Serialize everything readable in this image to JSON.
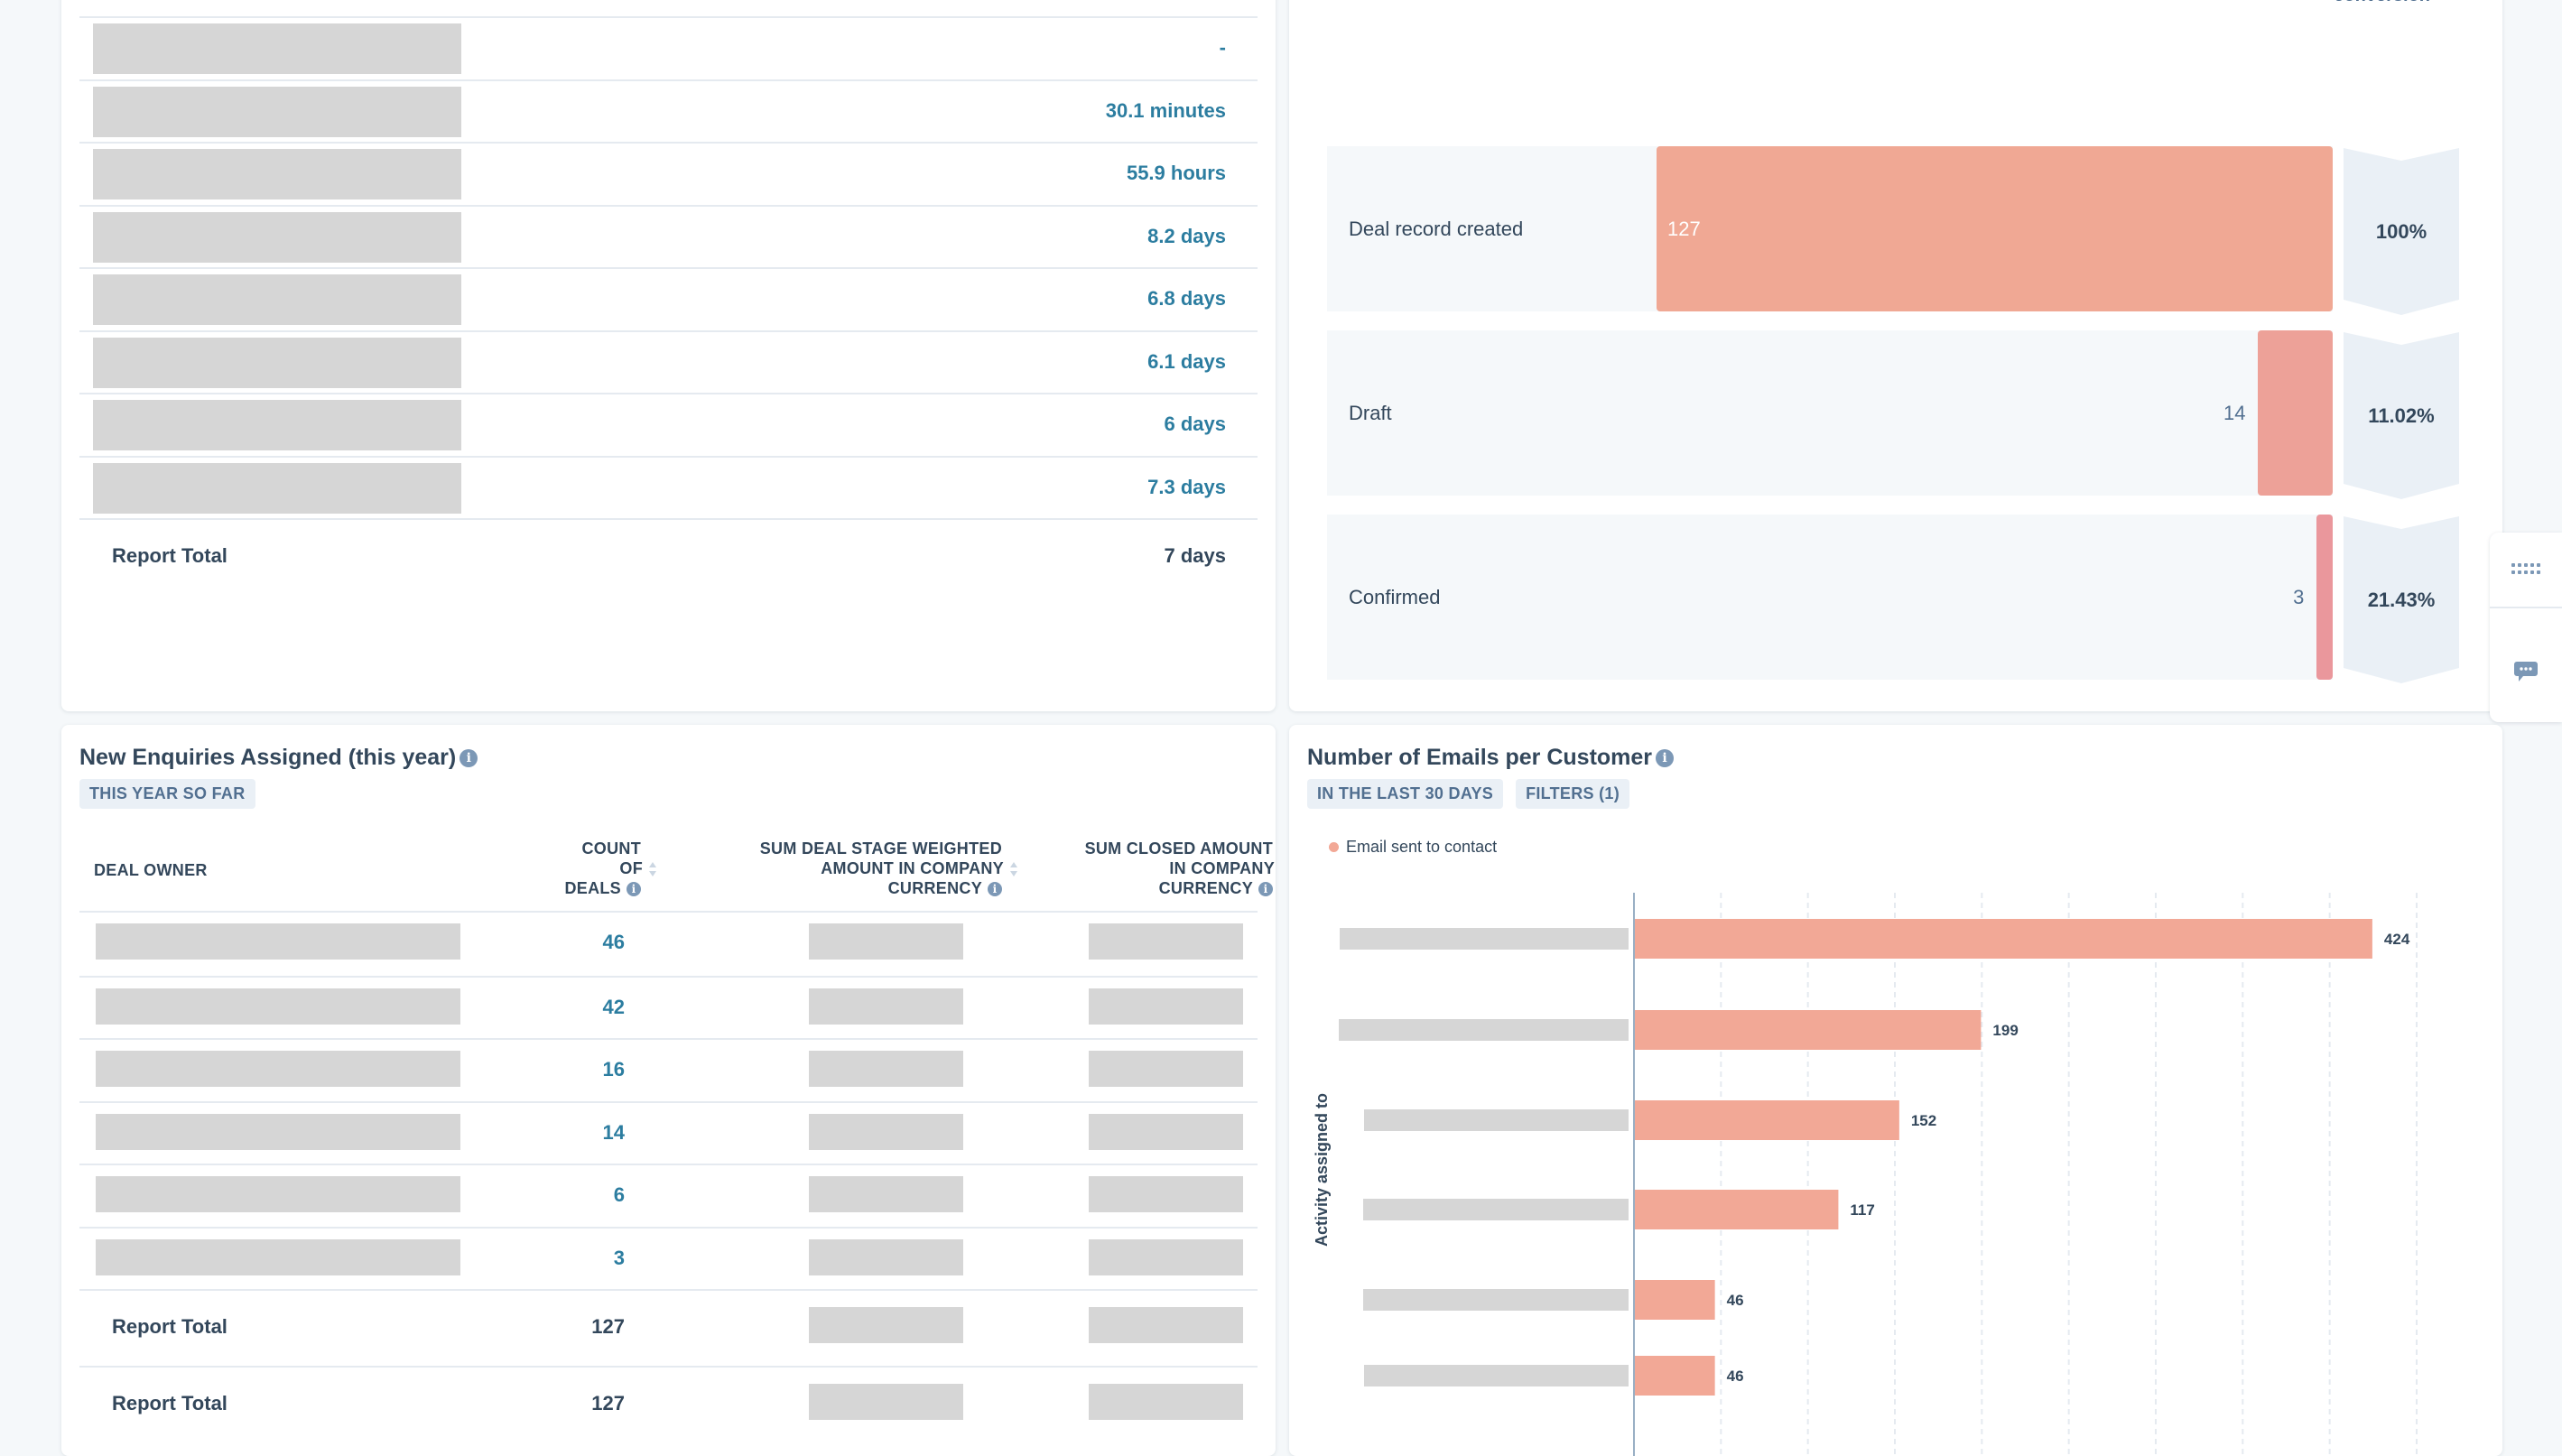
{
  "time_table": {
    "rows": [
      {
        "value": "-"
      },
      {
        "value": "30.1 minutes"
      },
      {
        "value": "55.9 hours"
      },
      {
        "value": "8.2 days"
      },
      {
        "value": "6.8 days"
      },
      {
        "value": "6.1 days"
      },
      {
        "value": "6 days"
      },
      {
        "value": "7.3 days"
      }
    ],
    "total_label": "Report Total",
    "total_value": "7 days"
  },
  "funnel": {
    "conversion_header": "conversion",
    "stages": [
      {
        "label": "Deal record created",
        "count": 127,
        "count_label": "127",
        "conversion": "100%",
        "color": "#f0a894"
      },
      {
        "label": "Draft",
        "count": 14,
        "count_label": "14",
        "conversion": "11.02%",
        "color": "#eda198"
      },
      {
        "label": "Confirmed",
        "count": 3,
        "count_label": "3",
        "conversion": "21.43%",
        "color": "#ea979c"
      }
    ]
  },
  "side_widget": {
    "icons": [
      "grid-icon",
      "chat-icon"
    ]
  },
  "enquiries": {
    "title": "New Enquiries Assigned (this year)",
    "tags": [
      "THIS YEAR SO FAR"
    ],
    "columns": {
      "owner": "DEAL OWNER",
      "count": [
        "COUNT",
        "OF",
        "DEALS"
      ],
      "weighted": [
        "SUM DEAL STAGE WEIGHTED",
        "AMOUNT IN COMPANY",
        "CURRENCY"
      ],
      "closed": [
        "SUM CLOSED AMOUNT",
        "IN COMPANY",
        "CURRENCY"
      ]
    },
    "rows": [
      {
        "count": "46"
      },
      {
        "count": "42"
      },
      {
        "count": "16"
      },
      {
        "count": "14"
      },
      {
        "count": "6"
      },
      {
        "count": "3"
      }
    ],
    "totals": [
      {
        "label": "Report Total",
        "count": "127"
      },
      {
        "label": "Report Total",
        "count": "127"
      }
    ]
  },
  "emails": {
    "title": "Number of Emails per Customer",
    "tags": [
      "IN THE LAST 30 DAYS",
      "FILTERS (1)"
    ]
  },
  "chart_data": {
    "type": "bar",
    "orientation": "horizontal",
    "title": "Number of Emails per Customer",
    "ylabel": "Activity assigned to",
    "xlabel": "",
    "categories": [
      "(redacted 1)",
      "(redacted 2)",
      "(redacted 3)",
      "(redacted 4)",
      "(redacted 5)",
      "(redacted 6)"
    ],
    "series": [
      {
        "name": "Email sent to contact",
        "color": "#f2a896",
        "values": [
          424,
          199,
          152,
          117,
          46,
          46
        ]
      }
    ],
    "xlim": [
      0,
      450
    ],
    "grid_step": 50,
    "grid": true,
    "legend_position": "top-left"
  }
}
